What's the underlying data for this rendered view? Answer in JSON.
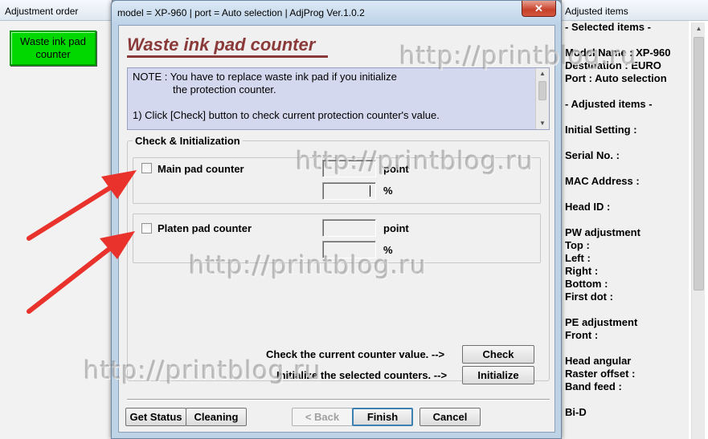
{
  "left_panel": {
    "title": "Adjustment order",
    "waste_button_line1": "Waste ink pad",
    "waste_button_line2": "counter"
  },
  "dialog": {
    "title": "model = XP-960 | port = Auto selection | AdjProg Ver.1.0.2",
    "close_glyph": "✕",
    "heading": "Waste ink pad counter",
    "note_line1": "NOTE : You have to replace waste ink pad if you initialize",
    "note_line2": "the protection counter.",
    "note_line3": "1) Click [Check] button to check current protection counter's value.",
    "group_label": "Check & Initialization",
    "main_pad": {
      "label": "Main pad counter",
      "point_value": "",
      "percent_value": "",
      "point_unit": "point",
      "percent_unit": "%",
      "checked": false
    },
    "platen_pad": {
      "label": "Platen pad counter",
      "point_value": "",
      "percent_value": "",
      "point_unit": "point",
      "percent_unit": "%",
      "checked": false
    },
    "check_hint": "Check the current counter value. -->",
    "check_button": "Check",
    "init_hint": "Initialize the selected counters. -->",
    "init_button": "Initialize",
    "get_status_button": "Get Status",
    "cleaning_button": "Cleaning",
    "back_button": "< Back",
    "finish_button": "Finish",
    "cancel_button": "Cancel"
  },
  "right_panel": {
    "title": "Adjusted items",
    "lines": [
      "- Selected items -",
      "",
      "Model Name : XP-960",
      "Destination : EURO",
      "Port : Auto selection",
      "",
      "- Adjusted items -",
      "",
      "Initial Setting :",
      "",
      "Serial No. :",
      "",
      "MAC Address :",
      "",
      "Head ID :",
      "",
      "PW adjustment",
      "Top :",
      "Left :",
      "Right :",
      "Bottom :",
      "First dot :",
      "",
      "PE adjustment",
      "Front :",
      "",
      "Head angular",
      " Raster offset :",
      " Band feed :",
      "",
      "Bi-D"
    ]
  },
  "watermark": "http://printblog.ru",
  "colors": {
    "waste_button": "#00d800",
    "heading": "#8b3a3a",
    "note_bg": "#d4d8ee",
    "arrow": "#e8322b",
    "close_button": "#c7402a"
  }
}
